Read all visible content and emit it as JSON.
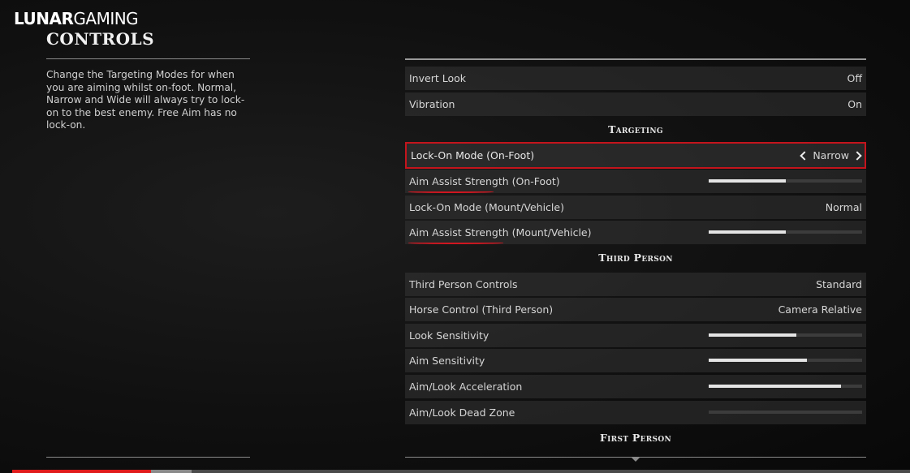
{
  "brand": {
    "part1": "LUNAR",
    "part2": "GAMING"
  },
  "page_title": "CONTROLS",
  "description": "Change the Targeting Modes for when you are aiming whilst on-foot. Normal, Narrow and Wide will always try to lock-on to the best enemy. Free Aim has no lock-on.",
  "sections": {
    "targeting": "Targeting",
    "third_person": "Third Person",
    "first_person": "First Person"
  },
  "rows": {
    "invert_look": {
      "label": "Invert Look",
      "value": "Off"
    },
    "vibration": {
      "label": "Vibration",
      "value": "On"
    },
    "lock_on_foot": {
      "label": "Lock-On Mode (On-Foot)",
      "value": "Narrow"
    },
    "aim_assist_foot": {
      "label": "Aim Assist Strength (On-Foot)",
      "level": 0.5
    },
    "lock_on_mount": {
      "label": "Lock-On Mode (Mount/Vehicle)",
      "value": "Normal"
    },
    "aim_assist_mount": {
      "label": "Aim Assist Strength (Mount/Vehicle)",
      "level": 0.5
    },
    "third_person_controls": {
      "label": "Third Person Controls",
      "value": "Standard"
    },
    "horse_control": {
      "label": "Horse Control (Third Person)",
      "value": "Camera Relative"
    },
    "look_sensitivity": {
      "label": "Look Sensitivity",
      "level": 0.57
    },
    "aim_sensitivity": {
      "label": "Aim Sensitivity",
      "level": 0.64
    },
    "aim_look_acceleration": {
      "label": "Aim/Look Acceleration",
      "level": 0.86
    },
    "aim_look_dead_zone": {
      "label": "Aim/Look Dead Zone",
      "level": 0.0
    }
  },
  "video_progress": {
    "played": 0.155,
    "buffered": 0.2
  },
  "colors": {
    "highlight": "#c4141c",
    "annotation": "#d01620",
    "progress": "#e01b1b"
  }
}
